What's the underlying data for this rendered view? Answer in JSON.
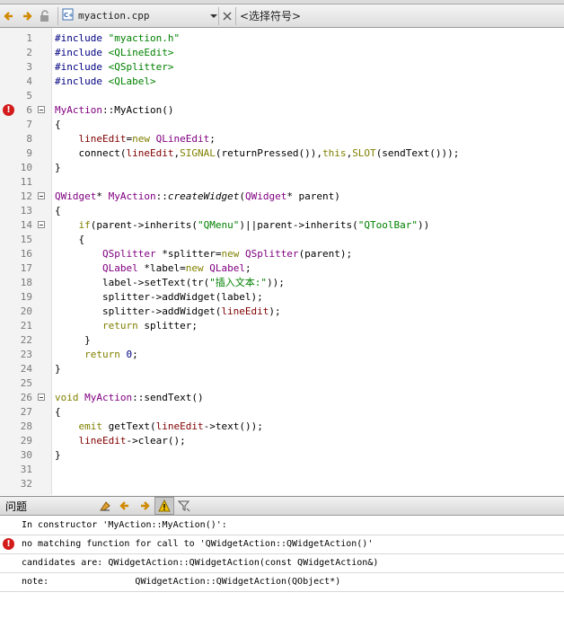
{
  "toolbar": {
    "file_name": "myaction.cpp",
    "symbol_combo": "<选择符号>"
  },
  "code_lines": [
    {
      "n": "1",
      "parts": [
        [
          "t-dir",
          "#include "
        ],
        [
          "t-str",
          "\"myaction.h\""
        ]
      ]
    },
    {
      "n": "2",
      "parts": [
        [
          "t-dir",
          "#include "
        ],
        [
          "t-str",
          "<QLineEdit>"
        ]
      ]
    },
    {
      "n": "3",
      "parts": [
        [
          "t-dir",
          "#include "
        ],
        [
          "t-str",
          "<QSplitter>"
        ]
      ]
    },
    {
      "n": "4",
      "parts": [
        [
          "t-dir",
          "#include "
        ],
        [
          "t-str",
          "<QLabel>"
        ]
      ]
    },
    {
      "n": "5",
      "parts": []
    },
    {
      "n": "6",
      "parts": [
        [
          "t-type",
          "MyAction"
        ],
        [
          "t-plain",
          "::MyAction()"
        ]
      ],
      "fold": true,
      "error": true
    },
    {
      "n": "7",
      "parts": [
        [
          "t-plain",
          "{"
        ]
      ]
    },
    {
      "n": "8",
      "parts": [
        [
          "t-plain",
          "    "
        ],
        [
          "t-memb",
          "lineEdit"
        ],
        [
          "t-plain",
          "="
        ],
        [
          "t-kw",
          "new "
        ],
        [
          "t-type",
          "QLineEdit"
        ],
        [
          "t-plain",
          ";"
        ]
      ]
    },
    {
      "n": "9",
      "parts": [
        [
          "t-plain",
          "    connect("
        ],
        [
          "t-memb",
          "lineEdit"
        ],
        [
          "t-plain",
          ","
        ],
        [
          "t-kw",
          "SIGNAL"
        ],
        [
          "t-plain",
          "(returnPressed()),"
        ],
        [
          "t-kw",
          "this"
        ],
        [
          "t-plain",
          ","
        ],
        [
          "t-kw",
          "SLOT"
        ],
        [
          "t-plain",
          "(sendText()));"
        ]
      ]
    },
    {
      "n": "10",
      "parts": [
        [
          "t-plain",
          "}"
        ]
      ]
    },
    {
      "n": "11",
      "parts": []
    },
    {
      "n": "12",
      "parts": [
        [
          "t-type",
          "QWidget"
        ],
        [
          "t-plain",
          "* "
        ],
        [
          "t-type",
          "MyAction"
        ],
        [
          "t-plain",
          "::"
        ],
        [
          "t-italic",
          "createWidget"
        ],
        [
          "t-plain",
          "("
        ],
        [
          "t-type",
          "QWidget"
        ],
        [
          "t-plain",
          "* parent)"
        ]
      ],
      "fold": true
    },
    {
      "n": "13",
      "parts": [
        [
          "t-plain",
          "{"
        ]
      ]
    },
    {
      "n": "14",
      "parts": [
        [
          "t-plain",
          "    "
        ],
        [
          "t-kw",
          "if"
        ],
        [
          "t-plain",
          "(parent->inherits("
        ],
        [
          "t-str",
          "\"QMenu\""
        ],
        [
          "t-plain",
          ")||parent->inherits("
        ],
        [
          "t-str",
          "\"QToolBar\""
        ],
        [
          "t-plain",
          "))"
        ]
      ],
      "fold": true
    },
    {
      "n": "15",
      "parts": [
        [
          "t-plain",
          "    {"
        ]
      ]
    },
    {
      "n": "16",
      "parts": [
        [
          "t-plain",
          "        "
        ],
        [
          "t-type",
          "QSplitter"
        ],
        [
          "t-plain",
          " *splitter="
        ],
        [
          "t-kw",
          "new "
        ],
        [
          "t-type",
          "QSplitter"
        ],
        [
          "t-plain",
          "(parent);"
        ]
      ]
    },
    {
      "n": "17",
      "parts": [
        [
          "t-plain",
          "        "
        ],
        [
          "t-type",
          "QLabel"
        ],
        [
          "t-plain",
          " *label="
        ],
        [
          "t-kw",
          "new "
        ],
        [
          "t-type",
          "QLabel"
        ],
        [
          "t-plain",
          ";"
        ]
      ]
    },
    {
      "n": "18",
      "parts": [
        [
          "t-plain",
          "        label->setText(tr("
        ],
        [
          "t-str",
          "\"插入文本:\""
        ],
        [
          "t-plain",
          "));"
        ]
      ]
    },
    {
      "n": "19",
      "parts": [
        [
          "t-plain",
          "        splitter->addWidget(label);"
        ]
      ]
    },
    {
      "n": "20",
      "parts": [
        [
          "t-plain",
          "        splitter->addWidget("
        ],
        [
          "t-memb",
          "lineEdit"
        ],
        [
          "t-plain",
          ");"
        ]
      ]
    },
    {
      "n": "21",
      "parts": [
        [
          "t-plain",
          "        "
        ],
        [
          "t-kw",
          "return"
        ],
        [
          "t-plain",
          " splitter;"
        ]
      ]
    },
    {
      "n": "22",
      "parts": [
        [
          "t-plain",
          "     }"
        ]
      ]
    },
    {
      "n": "23",
      "parts": [
        [
          "t-plain",
          "     "
        ],
        [
          "t-kw",
          "return"
        ],
        [
          "t-plain",
          " "
        ],
        [
          "t-num",
          "0"
        ],
        [
          "t-plain",
          ";"
        ]
      ]
    },
    {
      "n": "24",
      "parts": [
        [
          "t-plain",
          "}"
        ]
      ]
    },
    {
      "n": "25",
      "parts": []
    },
    {
      "n": "26",
      "parts": [
        [
          "t-kw",
          "void "
        ],
        [
          "t-type",
          "MyAction"
        ],
        [
          "t-plain",
          "::sendText()"
        ]
      ],
      "fold": true
    },
    {
      "n": "27",
      "parts": [
        [
          "t-plain",
          "{"
        ]
      ]
    },
    {
      "n": "28",
      "parts": [
        [
          "t-plain",
          "    "
        ],
        [
          "t-kw",
          "emit"
        ],
        [
          "t-plain",
          " getText("
        ],
        [
          "t-memb",
          "lineEdit"
        ],
        [
          "t-plain",
          "->text());"
        ]
      ]
    },
    {
      "n": "29",
      "parts": [
        [
          "t-plain",
          "    "
        ],
        [
          "t-memb",
          "lineEdit"
        ],
        [
          "t-plain",
          "->clear();"
        ]
      ]
    },
    {
      "n": "30",
      "parts": [
        [
          "t-plain",
          "}"
        ]
      ]
    },
    {
      "n": "31",
      "parts": []
    },
    {
      "n": "32",
      "parts": []
    }
  ],
  "issues": {
    "title": "问题",
    "rows": [
      {
        "text": "In constructor 'MyAction::MyAction()':",
        "error": false
      },
      {
        "text": "no matching function for call to 'QWidgetAction::QWidgetAction()'",
        "error": true
      },
      {
        "text": "candidates are: QWidgetAction::QWidgetAction(const QWidgetAction&)",
        "error": false
      },
      {
        "text": "note:                QWidgetAction::QWidgetAction(QObject*)",
        "error": false
      }
    ]
  },
  "colors": {
    "error": "#d41b1b",
    "keyword": "#808000",
    "type": "#800080",
    "string": "#008000",
    "directive": "#000080"
  }
}
